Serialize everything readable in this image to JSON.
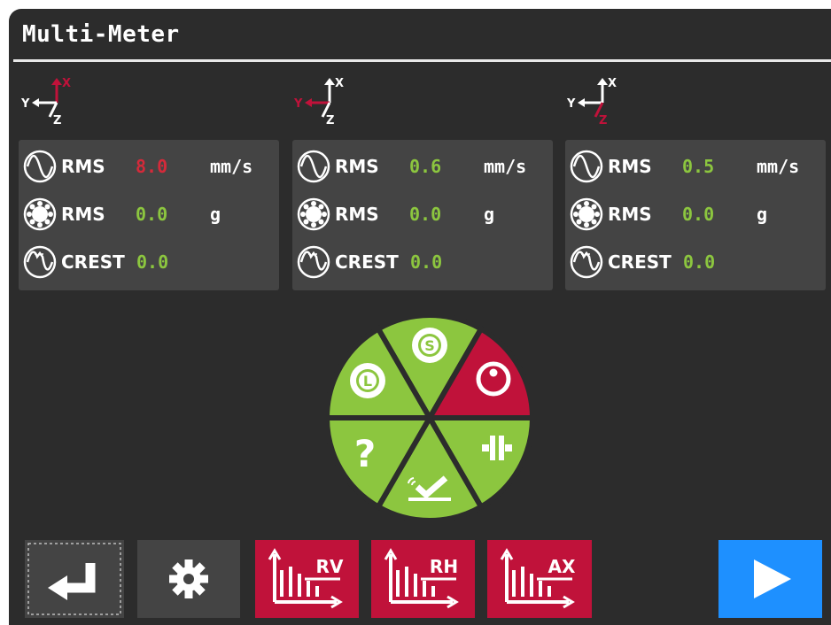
{
  "title": "Multi-Meter",
  "colors": {
    "background": "#2c2c2c",
    "panel": "#444444",
    "value_ok": "#8cc63f",
    "value_alarm": "#d42a3a",
    "accent_red": "#c0123a",
    "wheel_green": "#8cc63f",
    "play_blue": "#1e90ff"
  },
  "panels": [
    {
      "axis": {
        "x": "X",
        "y": "Y",
        "z": "Z",
        "highlight": "x"
      },
      "rows": [
        {
          "icon": "sine-wave-icon",
          "label": "RMS",
          "value": "8.0",
          "unit": "mm/s",
          "status": "alarm"
        },
        {
          "icon": "bearing-icon",
          "label": "RMS",
          "value": "0.0",
          "unit": "g",
          "status": "ok"
        },
        {
          "icon": "crest-wave-icon",
          "label": "CREST",
          "value": "0.0",
          "unit": "",
          "status": "ok"
        }
      ]
    },
    {
      "axis": {
        "x": "X",
        "y": "Y",
        "z": "Z",
        "highlight": "y"
      },
      "rows": [
        {
          "icon": "sine-wave-icon",
          "label": "RMS",
          "value": "0.6",
          "unit": "mm/s",
          "status": "ok"
        },
        {
          "icon": "bearing-icon",
          "label": "RMS",
          "value": "0.0",
          "unit": "g",
          "status": "ok"
        },
        {
          "icon": "crest-wave-icon",
          "label": "CREST",
          "value": "0.0",
          "unit": "",
          "status": "ok"
        }
      ]
    },
    {
      "axis": {
        "x": "X",
        "y": "Y",
        "z": "Z",
        "highlight": "z"
      },
      "rows": [
        {
          "icon": "sine-wave-icon",
          "label": "RMS",
          "value": "0.5",
          "unit": "mm/s",
          "status": "ok"
        },
        {
          "icon": "bearing-icon",
          "label": "RMS",
          "value": "0.0",
          "unit": "g",
          "status": "ok"
        },
        {
          "icon": "crest-wave-icon",
          "label": "CREST",
          "value": "0.0",
          "unit": "",
          "status": "ok"
        }
      ]
    }
  ],
  "wheel": {
    "segments": [
      {
        "name": "shaft-bearing",
        "icon": "bearing-s-icon",
        "status": "ok",
        "letter": "S"
      },
      {
        "name": "unbalance",
        "icon": "unbalance-icon",
        "status": "alarm"
      },
      {
        "name": "coupling",
        "icon": "coupling-icon",
        "status": "ok"
      },
      {
        "name": "mounting",
        "icon": "mounting-check-icon",
        "status": "ok"
      },
      {
        "name": "unknown",
        "icon": "question-icon",
        "status": "ok",
        "letter": "?"
      },
      {
        "name": "load-bearing",
        "icon": "bearing-l-icon",
        "status": "ok",
        "letter": "L"
      }
    ]
  },
  "toolbar": {
    "back": {
      "icon": "enter-return-icon"
    },
    "settings": {
      "icon": "gear-icon"
    },
    "spectra": [
      {
        "label": "RV",
        "icon": "spectrum-chart-icon"
      },
      {
        "label": "RH",
        "icon": "spectrum-chart-icon"
      },
      {
        "label": "AX",
        "icon": "spectrum-chart-icon"
      }
    ],
    "play": {
      "icon": "play-icon"
    }
  }
}
